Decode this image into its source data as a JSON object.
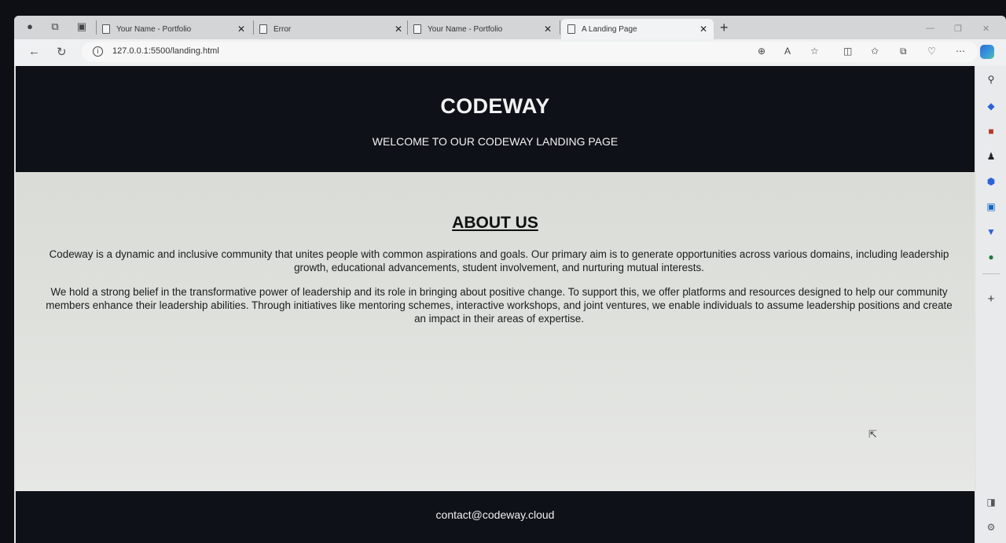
{
  "browser": {
    "tabs": [
      {
        "title": "Your Name - Portfolio"
      },
      {
        "title": "Error"
      },
      {
        "title": "Your Name - Portfolio"
      },
      {
        "title": "A Landing Page"
      }
    ],
    "url": "127.0.0.1:5500/landing.html"
  },
  "hero": {
    "title": "CODEWAY",
    "subtitle": "WELCOME TO OUR CODEWAY LANDING PAGE"
  },
  "about": {
    "title": "ABOUT US",
    "paragraph1": "Codeway is a dynamic and inclusive community that unites people with common aspirations and goals. Our primary aim is to generate opportunities across various domains, including leadership growth, educational advancements, student involvement, and nurturing mutual interests.",
    "paragraph2": "We hold a strong belief in the transformative power of leadership and its role in bringing about positive change. To support this, we offer platforms and resources designed to help our community members enhance their leadership abilities. Through initiatives like mentoring schemes, interactive workshops, and joint ventures, we enable individuals to assume leadership positions and create an impact in their areas of expertise."
  },
  "footer": {
    "contact": "contact@codeway.cloud"
  },
  "colors": {
    "header_bg": "#0e1118",
    "page_bg": "#dcded9"
  }
}
